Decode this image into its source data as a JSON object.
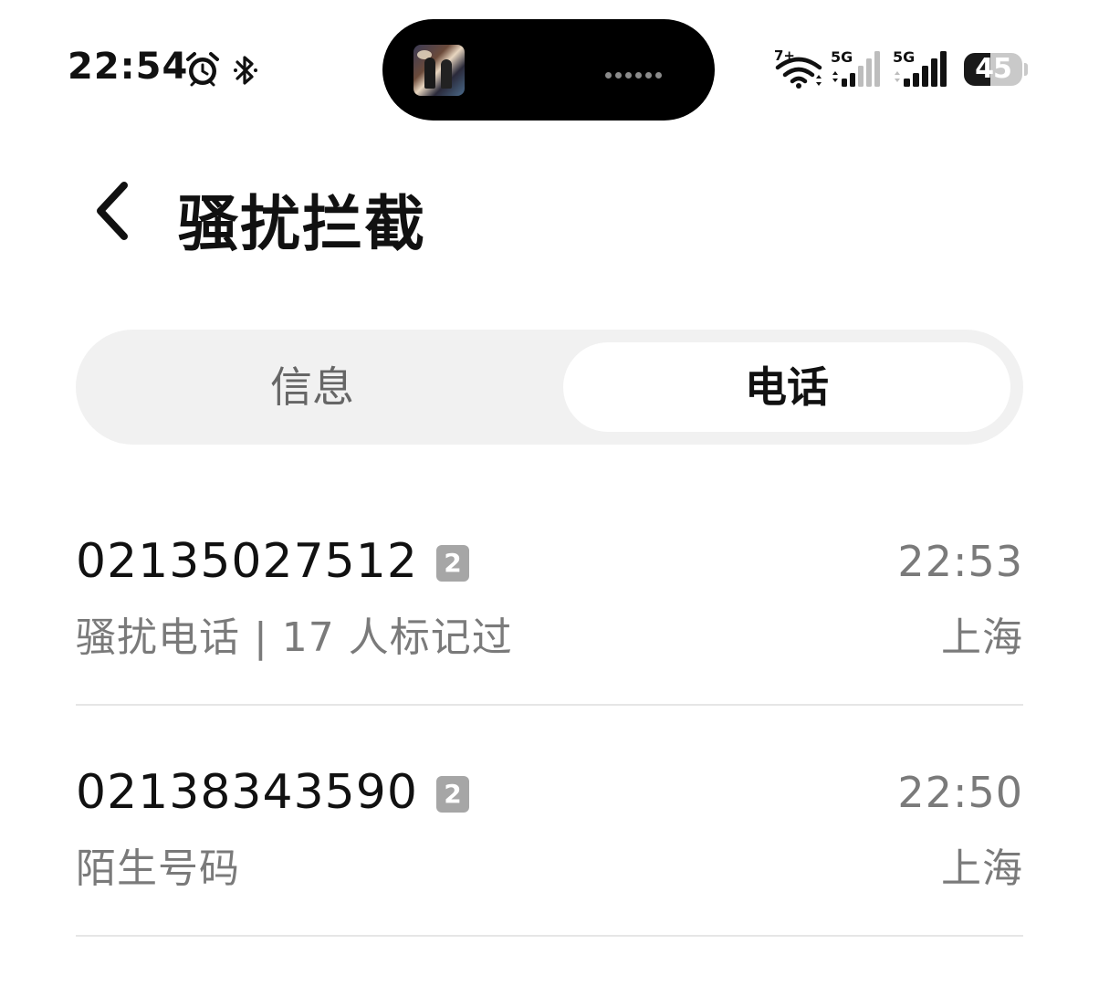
{
  "status_bar": {
    "time": "22:54",
    "wifi_badge": "7+",
    "sim1_label": "5G",
    "sim2_label": "5G",
    "battery_percent": "45",
    "battery_level": 0.45,
    "icons": [
      "alarm-icon",
      "bluetooth-icon",
      "wifi-icon",
      "cellular-signal-icon",
      "battery-icon"
    ]
  },
  "header": {
    "title": "骚扰拦截"
  },
  "tabs": [
    {
      "label": "信息",
      "selected": false
    },
    {
      "label": "电话",
      "selected": true
    }
  ],
  "calls": [
    {
      "number": "02135027512",
      "sim": "2",
      "description": "骚扰电话 | 17 人标记过",
      "time": "22:53",
      "location": "上海"
    },
    {
      "number": "02138343590",
      "sim": "2",
      "description": "陌生号码",
      "time": "22:50",
      "location": "上海"
    }
  ],
  "colors": {
    "background": "#ffffff",
    "tab_track": "#f1f1f1",
    "secondary_text": "#7a7a7a",
    "sim_badge": "#a6a6a6"
  }
}
